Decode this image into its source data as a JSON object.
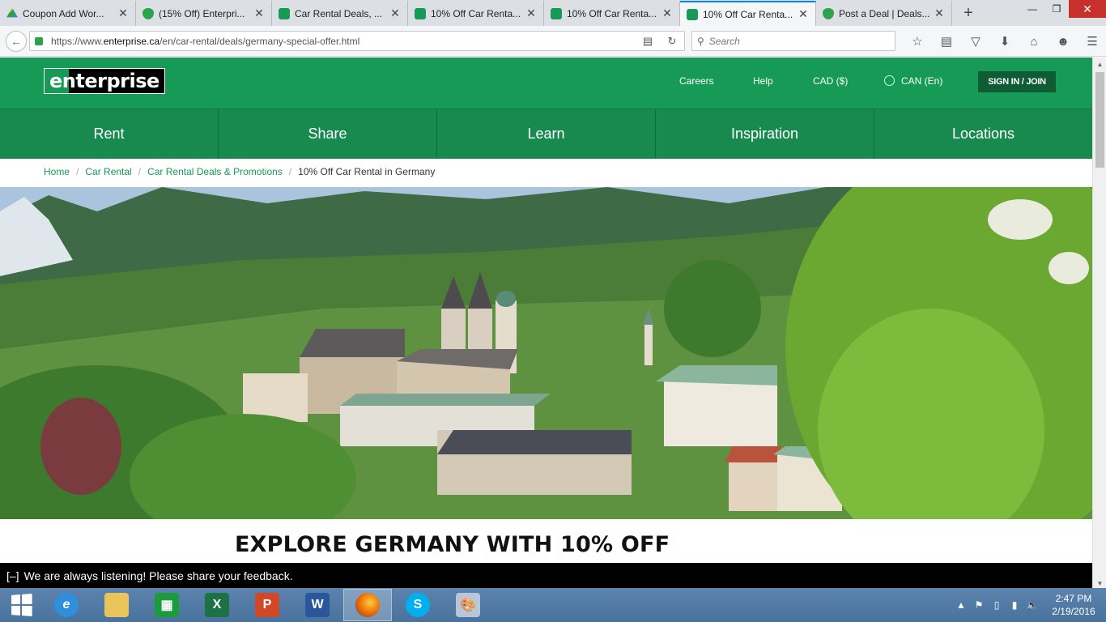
{
  "tabs": [
    {
      "label": "Coupon Add Wor...",
      "fav": "drive",
      "active": false
    },
    {
      "label": "(15% Off) Enterpri...",
      "fav": "shield",
      "active": false
    },
    {
      "label": "Car Rental Deals, ...",
      "fav": "ent",
      "active": false
    },
    {
      "label": "10% Off Car Renta...",
      "fav": "ent",
      "active": false
    },
    {
      "label": "10% Off Car Renta...",
      "fav": "ent",
      "active": false
    },
    {
      "label": "10% Off Car Renta...",
      "fav": "ent",
      "active": true
    },
    {
      "label": "Post a Deal | Deals...",
      "fav": "shield",
      "active": false
    }
  ],
  "url": {
    "prefix": "https://www.",
    "domain": "enterprise.ca",
    "path": "/en/car-rental/deals/germany-special-offer.html"
  },
  "search": {
    "placeholder": "Search"
  },
  "header": {
    "logo_text": "enterprise",
    "links": {
      "careers": "Careers",
      "help": "Help",
      "currency": "CAD ($)",
      "locale": "CAN (En)"
    },
    "signin": "SIGN IN / JOIN"
  },
  "mainnav": [
    "Rent",
    "Share",
    "Learn",
    "Inspiration",
    "Locations"
  ],
  "breadcrumb": {
    "home": "Home",
    "car_rental": "Car Rental",
    "deals": "Car Rental Deals & Promotions",
    "current": "10% Off Car Rental in Germany",
    "sep": "/"
  },
  "headline": "EXPLORE GERMANY WITH 10% OFF",
  "feedback": {
    "toggle": "[–]",
    "text": "We are always listening! Please share your feedback."
  },
  "clock": {
    "time": "2:47 PM",
    "date": "2/19/2016"
  },
  "colors": {
    "brand_green": "#169a55",
    "nav_green": "#188a4f",
    "dark_green": "#0d5c33"
  }
}
